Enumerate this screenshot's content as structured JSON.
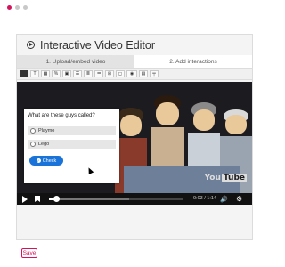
{
  "window": {
    "dot_colors": [
      "#d4145a",
      "#c8c8c8",
      "#c8c8c8"
    ]
  },
  "editor": {
    "title": "Interactive Video Editor",
    "title_icon": "play-circle-icon",
    "tabs": [
      {
        "label": "1. Upload/embed video",
        "active": false
      },
      {
        "label": "2. Add interactions",
        "active": true
      }
    ],
    "toolbar": {
      "buttons": [
        "stop-icon",
        "text-icon",
        "table-icon",
        "link-icon",
        "image-icon",
        "single-choice-icon",
        "multiple-choice-icon",
        "list-icon",
        "drag-words-icon",
        "dialog-icon",
        "visibility-icon",
        "summary-icon",
        "navigation-icon"
      ]
    }
  },
  "question": {
    "title": "What are these guys called?",
    "options": [
      "Playmo",
      "Lego"
    ],
    "check_label": "Check"
  },
  "video": {
    "brand_a": "You",
    "brand_b": "Tube",
    "time": "0:03 / 1:14",
    "progress": 0.05
  },
  "save_label": "Save",
  "colors": {
    "accent": "#d4145a",
    "button_blue": "#1a73d9"
  }
}
